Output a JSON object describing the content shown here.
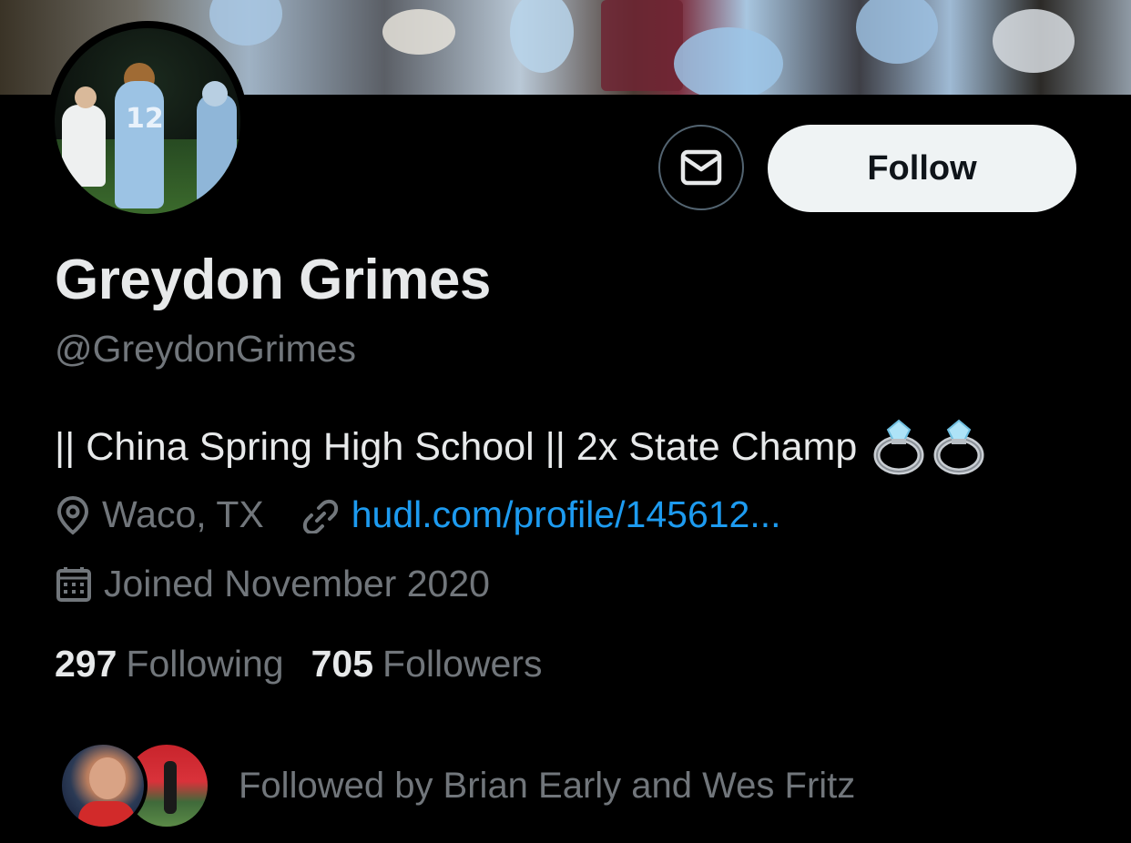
{
  "profile": {
    "name": "Greydon Grimes",
    "handle": "@GreydonGrimes",
    "bio_text": "|| China Spring High School || 2x State Champ",
    "bio_emoji": [
      "ring",
      "ring"
    ],
    "location": "Waco, TX",
    "website": "hudl.com/profile/145612...",
    "joined": "Joined November 2020"
  },
  "actions": {
    "message_icon": "envelope-icon",
    "follow_label": "Follow"
  },
  "stats": {
    "following_count": "297",
    "following_label": "Following",
    "followers_count": "705",
    "followers_label": "Followers"
  },
  "followed_by": {
    "text": "Followed by Brian Early and Wes Fritz"
  },
  "colors": {
    "background": "#000000",
    "primary_text": "#e7e9ea",
    "secondary_text": "#71767b",
    "link": "#1d9bf0",
    "follow_button_bg": "#eff3f4",
    "follow_button_text": "#0f1419",
    "border": "#536471"
  }
}
